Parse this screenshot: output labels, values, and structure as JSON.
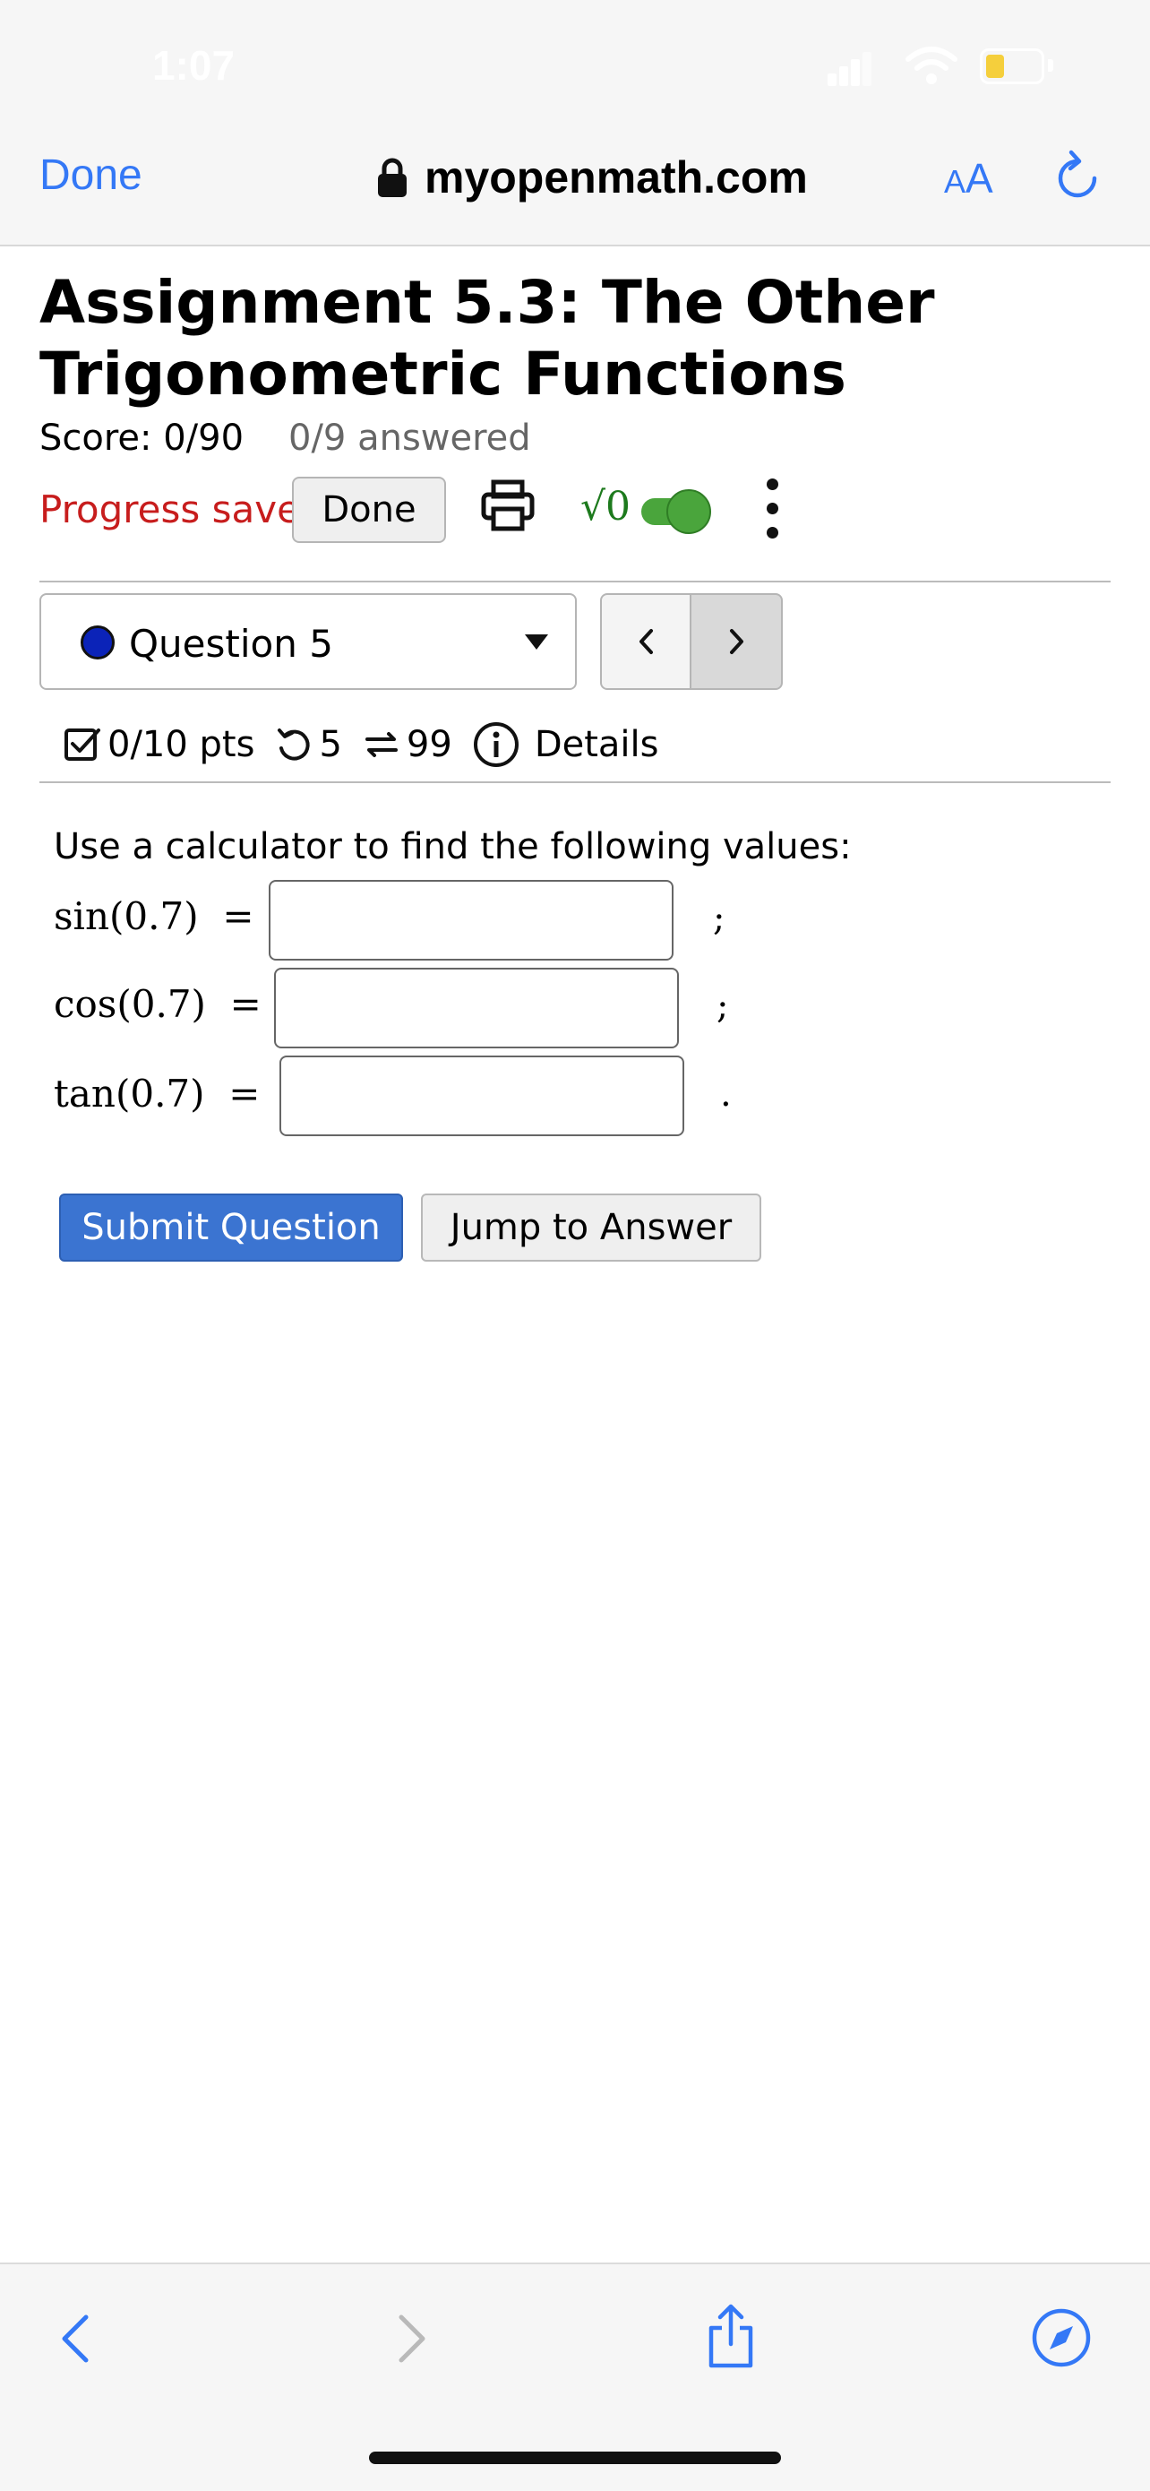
{
  "status_bar": {
    "time": "1:07"
  },
  "browser": {
    "done_label": "Done",
    "url": "myopenmath.com",
    "text_size_small": "A",
    "text_size_large": "A"
  },
  "assignment": {
    "title": "Assignment 5.3: The Other Trigonometric Functions",
    "score": "Score: 0/90",
    "answered": "0/9 answered",
    "progress_status": "Progress saved",
    "done_button": "Done",
    "math_toggle_label": "√0"
  },
  "question": {
    "selector_label": "Question 5",
    "points": "0/10 pts",
    "retries": "5",
    "versions": "99",
    "details_label": "Details",
    "prompt": "Use a calculator to find the following values:",
    "rows": [
      {
        "expr": "sin(0.7)",
        "equals": "=",
        "value": "",
        "separator": ";"
      },
      {
        "expr": "cos(0.7)",
        "equals": "=",
        "value": "",
        "separator": ";"
      },
      {
        "expr": "tan(0.7)",
        "equals": "=",
        "value": "",
        "separator": "."
      }
    ],
    "submit_label": "Submit Question",
    "jump_label": "Jump to Answer"
  },
  "colors": {
    "link_blue": "#3478f6",
    "progress_red": "#c71d1d",
    "submit_blue": "#3b74d1",
    "toggle_green": "#4aa53c",
    "question_dot": "#0b23b8"
  }
}
